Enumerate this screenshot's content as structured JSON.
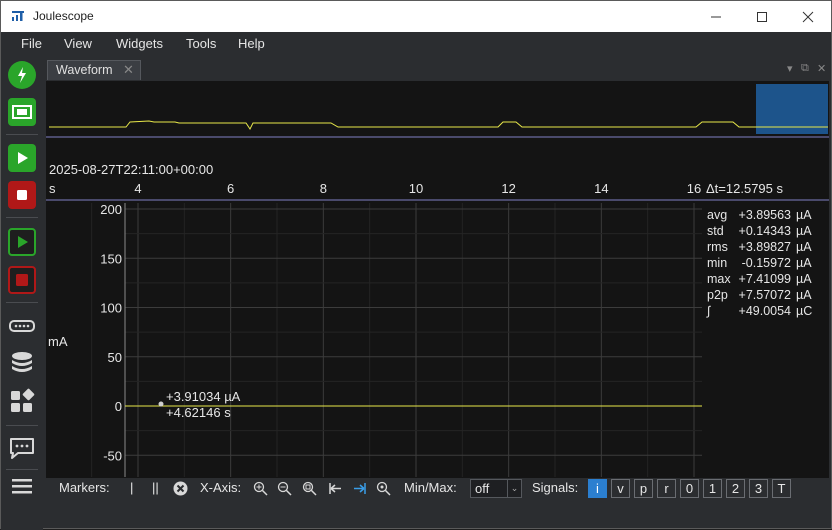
{
  "window": {
    "title": "Joulescope"
  },
  "menu": [
    "File",
    "View",
    "Widgets",
    "Tools",
    "Help"
  ],
  "toolbar": {
    "items": [
      "power-icon",
      "multimeter-icon",
      "play-icon",
      "stop-icon",
      "record-icon",
      "stop-record-icon",
      "device-icon",
      "database-icon",
      "widgets-icon",
      "chat-icon",
      "menu-icon"
    ]
  },
  "tab": {
    "label": "Waveform",
    "close": "✕"
  },
  "overview": {
    "timestamp": "2025-08-27T22:11:00+00:00"
  },
  "xaxis": {
    "unit": "s",
    "ticks": [
      "4",
      "6",
      "8",
      "10",
      "12",
      "14",
      "16"
    ],
    "delta": "Δt=12.5795 s"
  },
  "yaxis": {
    "unit": "mA",
    "ticks": [
      "200",
      "150",
      "100",
      "50",
      "0",
      "-50"
    ]
  },
  "stats": [
    {
      "name": "avg",
      "value": "+3.89563",
      "unit": "µA"
    },
    {
      "name": "std",
      "value": "+0.14343",
      "unit": "µA"
    },
    {
      "name": "rms",
      "value": "+3.89827",
      "unit": "µA"
    },
    {
      "name": "min",
      "value": "-0.15972",
      "unit": "µA"
    },
    {
      "name": "max",
      "value": "+7.41099",
      "unit": "µA"
    },
    {
      "name": "p2p",
      "value": "+7.57072",
      "unit": "µA"
    },
    {
      "name": "∫",
      "value": "+49.0054",
      "unit": "µC"
    }
  ],
  "marker": {
    "value": "+3.91034 µA",
    "time": "+4.62146 s"
  },
  "bottom": {
    "markers_label": "Markers:",
    "marker_single": "|",
    "marker_dual": "||",
    "xaxis_label": "X-Axis:",
    "minmax_label": "Min/Max:",
    "minmax_value": "off",
    "signals_label": "Signals:",
    "signals": [
      "i",
      "v",
      "p",
      "r",
      "0",
      "1",
      "2",
      "3",
      "T"
    ]
  },
  "colors": {
    "trace": "#e8e84a",
    "accent": "#2b7fd0",
    "selection": "#1e5fa0"
  }
}
